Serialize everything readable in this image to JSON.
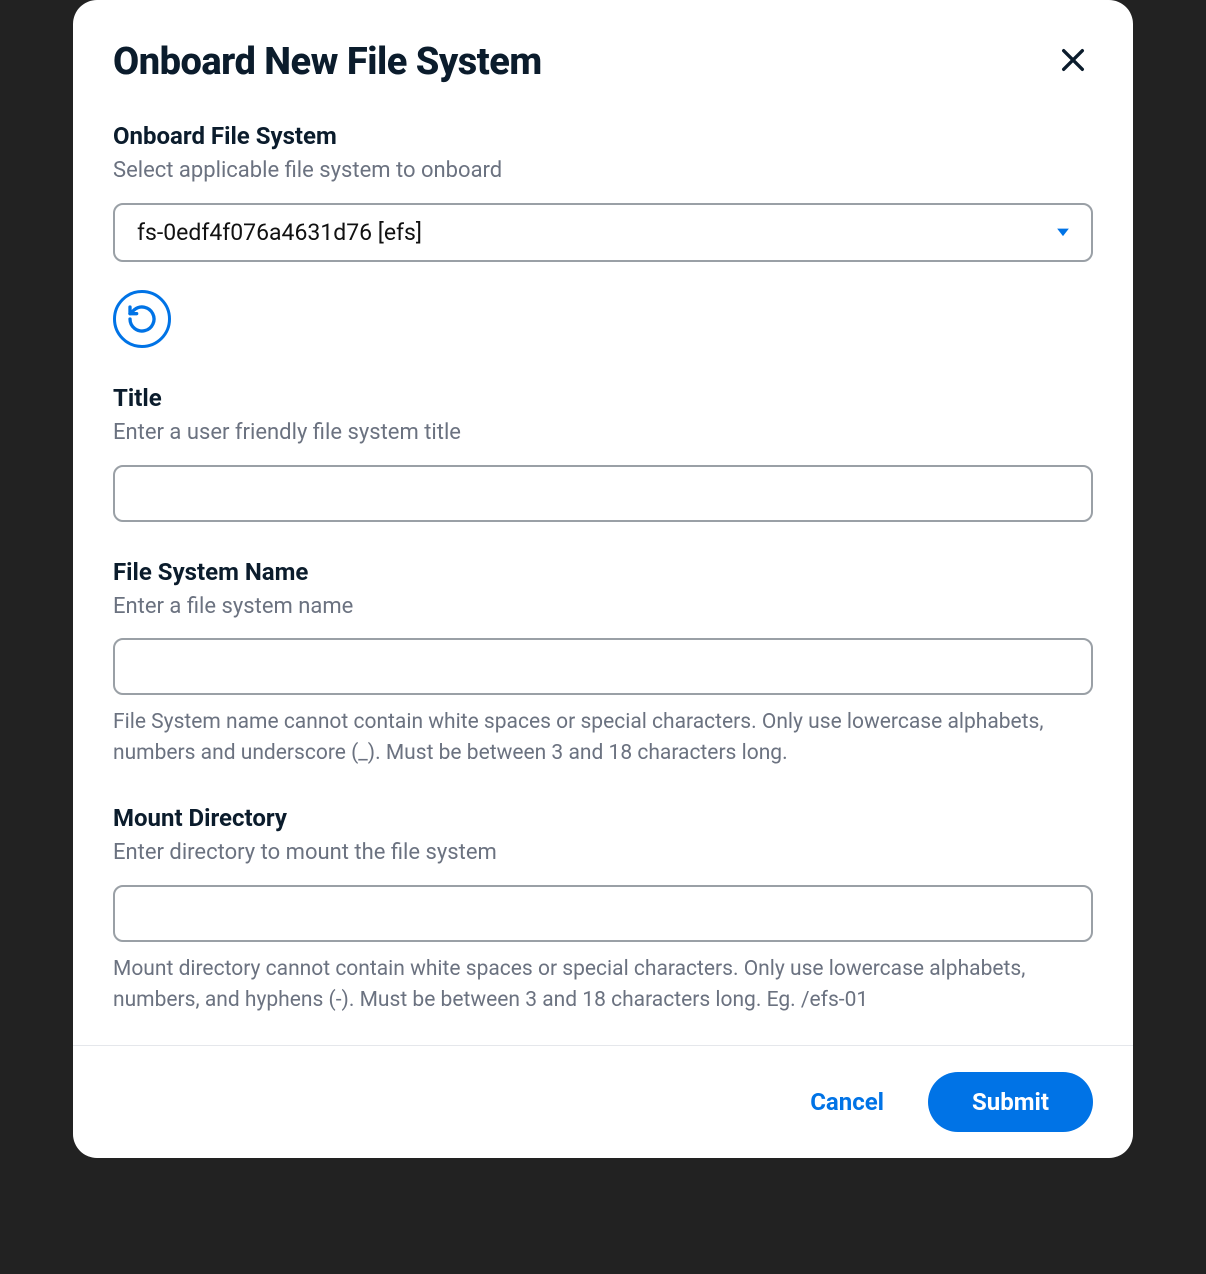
{
  "header": {
    "title": "Onboard New File System"
  },
  "form": {
    "filesystem": {
      "label": "Onboard File System",
      "description": "Select applicable file system to onboard",
      "selected": "fs-0edf4f076a4631d76 [efs]"
    },
    "title": {
      "label": "Title",
      "description": "Enter a user friendly file system title",
      "value": ""
    },
    "name": {
      "label": "File System Name",
      "description": "Enter a file system name",
      "value": "",
      "help": "File System name cannot contain white spaces or special characters. Only use lowercase alphabets, numbers and underscore (_). Must be between 3 and 18 characters long."
    },
    "mount": {
      "label": "Mount Directory",
      "description": "Enter directory to mount the file system",
      "value": "",
      "help": "Mount directory cannot contain white spaces or special characters. Only use lowercase alphabets, numbers, and hyphens (-). Must be between 3 and 18 characters long. Eg. /efs-01"
    }
  },
  "footer": {
    "cancel": "Cancel",
    "submit": "Submit"
  }
}
